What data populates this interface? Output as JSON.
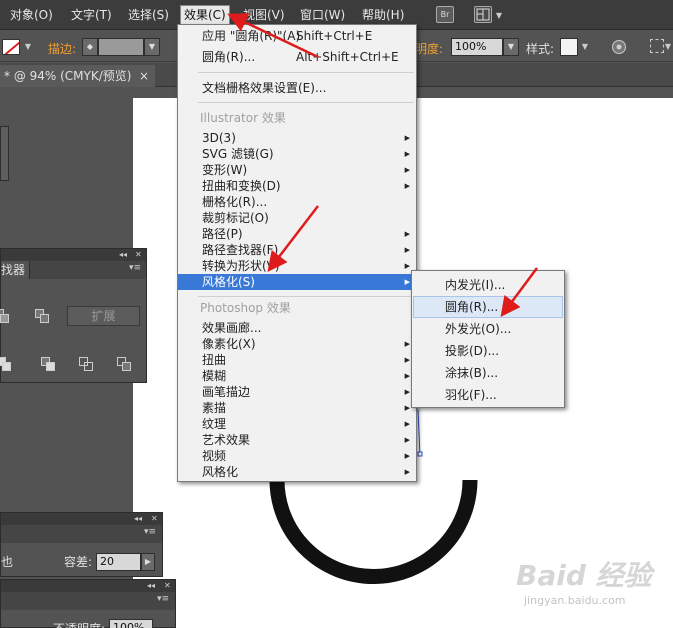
{
  "menubar": {
    "items": [
      "对象(O)",
      "文字(T)",
      "选择(S)",
      "效果(C)",
      "视图(V)",
      "窗口(W)",
      "帮助(H)"
    ],
    "br_icon": "Br"
  },
  "control_bar": {
    "stroke_label": "描边:",
    "opacity_label": "明度:",
    "opacity_value": "100%",
    "style_label": "样式:"
  },
  "document_tab": {
    "title": "* @ 94% (CMYK/预览)",
    "close": "×"
  },
  "effect_menu": {
    "items": [
      {
        "label": "应用 \"圆角(R)\"(A)",
        "shortcut": "Shift+Ctrl+E"
      },
      {
        "label": "圆角(R)...",
        "shortcut": "Alt+Shift+Ctrl+E"
      },
      {
        "label": "文档栅格效果设置(E)..."
      },
      {
        "label": "Illustrator 效果",
        "section": true
      },
      {
        "label": "3D(3)",
        "submenu": true
      },
      {
        "label": "SVG 滤镜(G)",
        "submenu": true
      },
      {
        "label": "变形(W)",
        "submenu": true
      },
      {
        "label": "扭曲和变换(D)",
        "submenu": true
      },
      {
        "label": "栅格化(R)..."
      },
      {
        "label": "裁剪标记(O)"
      },
      {
        "label": "路径(P)",
        "submenu": true
      },
      {
        "label": "路径查找器(F)",
        "submenu": true
      },
      {
        "label": "转换为形状(V)",
        "submenu": true
      },
      {
        "label": "风格化(S)",
        "submenu": true,
        "highlighted": true
      },
      {
        "label": "Photoshop 效果",
        "section": true
      },
      {
        "label": "效果画廊..."
      },
      {
        "label": "像素化(X)",
        "submenu": true
      },
      {
        "label": "扭曲",
        "submenu": true
      },
      {
        "label": "模糊",
        "submenu": true
      },
      {
        "label": "画笔描边",
        "submenu": true
      },
      {
        "label": "素描",
        "submenu": true
      },
      {
        "label": "纹理",
        "submenu": true
      },
      {
        "label": "艺术效果",
        "submenu": true
      },
      {
        "label": "视频",
        "submenu": true
      },
      {
        "label": "风格化",
        "submenu": true
      }
    ]
  },
  "stylize_submenu": {
    "items": [
      {
        "label": "内发光(I)..."
      },
      {
        "label": "圆角(R)...",
        "highlighted": true
      },
      {
        "label": "外发光(O)..."
      },
      {
        "label": "投影(D)..."
      },
      {
        "label": "涂抹(B)..."
      },
      {
        "label": "羽化(F)..."
      }
    ]
  },
  "pathfinder_panel": {
    "title": "找器",
    "expand_button": "扩展"
  },
  "lower_panel": {
    "left_text": "也",
    "tolerance_label": "容差:",
    "tolerance_value": "20"
  },
  "bottom_panel": {
    "opacity_label": "不透明度:",
    "opacity_value": "100%"
  },
  "watermark": {
    "main": "Baid 经验",
    "sub": "jingyan.baidu.com"
  },
  "colors": {
    "menu_highlight": "#3a78d8",
    "annotation_arrow": "#e01b1b",
    "ring": "#111111"
  }
}
